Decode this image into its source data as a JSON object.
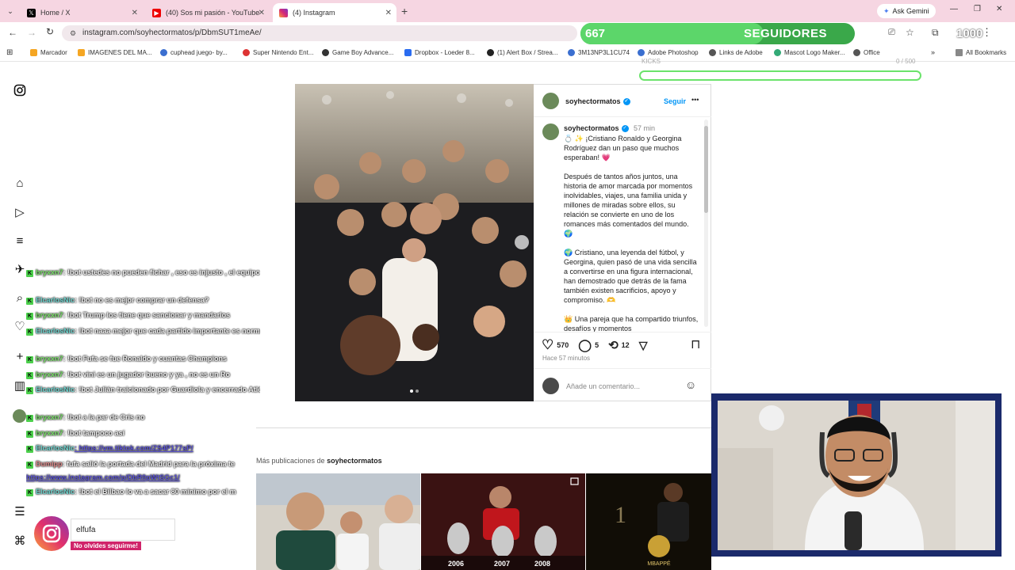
{
  "tabs": [
    {
      "title": "Home / X",
      "icon": "x-logo-icon"
    },
    {
      "title": "(40) Sos mi pasión - YouTube",
      "icon": "youtube-icon"
    },
    {
      "title": "(4) Instagram",
      "icon": "instagram-icon",
      "active": true
    }
  ],
  "browser": {
    "url": "instagram.com/soyhectormatos/p/DbmSUT1meAe/",
    "ask_gemini": "Ask Gemini",
    "all_bookmarks": "All Bookmarks"
  },
  "bookmarks": [
    "Marcador",
    "IMAGENES DEL MA...",
    "cuphead juego- by...",
    "Super Nintendo Ent...",
    "Game Boy Advance...",
    "Dropbox - Loeder 8...",
    "(1) Alert Box / Strea...",
    "3M13NP3L1CU74",
    "Adobe Photoshop",
    "Links de Adobe",
    "Mascot Logo Maker...",
    "Office"
  ],
  "followers_overlay": {
    "current": "667",
    "label": "SEGUIDORES",
    "goal": "1000",
    "progress": 0.667,
    "kicks_label": "KICKS",
    "kicks_count": "0 / 500"
  },
  "post": {
    "username": "soyhectormatos",
    "follow": "Seguir",
    "more": "•••",
    "time": "57 min",
    "caption": [
      "💍 ✨ ¡Cristiano Ronaldo y Georgina Rodríguez dan un paso que muchos esperaban! 💗",
      "Después de tantos años juntos, una historia de amor marcada por momentos inolvidables, viajes, una familia unida y millones de miradas sobre ellos, su relación se convierte en uno de los romances más comentados del mundo. 🌍",
      "🌍 Cristiano, una leyenda del fútbol, y Georgina, quien pasó de una vida sencilla a convertirse en una figura internacional, han demostrado que detrás de la fama también existen sacrificios, apoyo y compromiso. 🫶",
      "👑 Una pareja que ha compartido triunfos, desafíos y momentos"
    ],
    "likes": "570",
    "comments": "5",
    "reposts": "12",
    "posted_ago": "Hace 57 minutos",
    "comment_placeholder": "Añade un comentario..."
  },
  "more_posts": {
    "prefix": "Más publicaciones de",
    "user": "soyhectormatos"
  },
  "thumb_labels": {
    "years": [
      "2006",
      "2007",
      "2008"
    ],
    "rank": "1",
    "name": "MBAPPÉ"
  },
  "chat": [
    {
      "user": "bryxxn7",
      "cls": "u1",
      "msg": ": !bot ustedes no pueden fichar , eso es injusto , el equipo"
    },
    {
      "user": "ElcarlosNic",
      "cls": "u2",
      "msg": ": !bot no es mejor comprar un defensa?"
    },
    {
      "user": "bryxxn7",
      "cls": "u1",
      "msg": ": !bot Trump los tiene que sancionar y mandarlos"
    },
    {
      "user": "ElcarlosNic",
      "cls": "u2",
      "msg": ": !bot naaa mejor que cada partido importante es normal 👍"
    },
    {
      "user": "bryxxn7",
      "cls": "u1",
      "msg": ": !bot Fufa se fue Ronaldo y cuantas Champions"
    },
    {
      "user": "bryxxn7",
      "cls": "u1",
      "msg": ": !bot vini es un jugador bueno y ya , no es un Ro"
    },
    {
      "user": "ElcarlosNic",
      "cls": "u2",
      "msg": ": !bot Julián traicionado por Guardiola y encerrado Atlético de Madrid"
    },
    {
      "user": "bryxxn7",
      "cls": "u1",
      "msg": ": !bot a la par de Cris no"
    },
    {
      "user": "bryxxn7",
      "cls": "u1",
      "msg": ": !bot tampoco así"
    },
    {
      "user": "ElcarlosNic",
      "cls": "u2",
      "msg": ": https://vm.tiktok.com/ZS4P177sP/"
    },
    {
      "user": "Dumipp",
      "cls": "u3",
      "msg": ": fufa salió la portada del Madrid para la próxima te"
    },
    {
      "user": "",
      "cls": "u3",
      "msg": "https://www.instagram.com/p/DbR0pWtSGc1/"
    },
    {
      "user": "ElcarlosNic",
      "cls": "u2",
      "msg": ": !bot el Bilbao lo va a sacar 80 mínimo por el m"
    }
  ],
  "ig_promo": {
    "handle": "elfufa",
    "tagline": "No olvides seguirme!"
  }
}
